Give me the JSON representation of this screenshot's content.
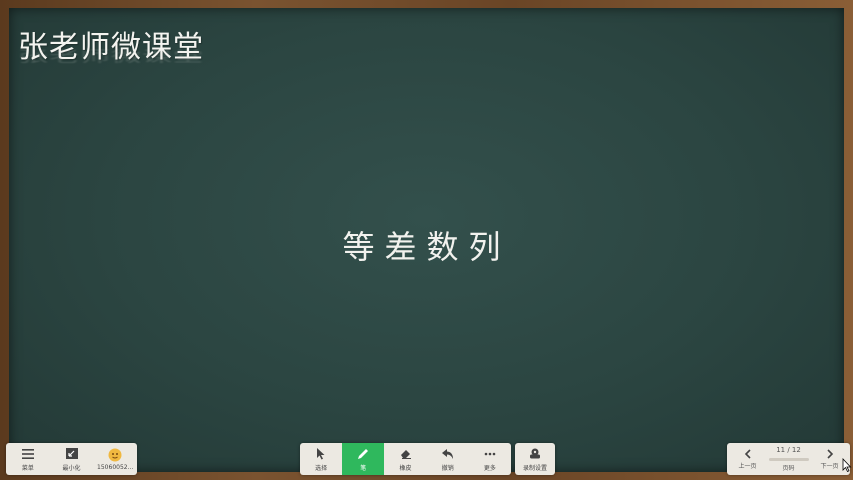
{
  "board": {
    "title": "张老师微课堂",
    "content_text": "等差数列"
  },
  "toolbar_left": [
    {
      "label": "菜单",
      "icon": "menu-icon"
    },
    {
      "label": "最小化",
      "icon": "minimize-icon"
    },
    {
      "label": "15060052...",
      "icon": "avatar-icon"
    }
  ],
  "toolbar_tools": [
    {
      "label": "选择",
      "icon": "pointer-icon"
    },
    {
      "label": "笔",
      "icon": "pen-icon"
    },
    {
      "label": "橡皮",
      "icon": "eraser-icon"
    },
    {
      "label": "撤销",
      "icon": "undo-icon"
    },
    {
      "label": "更多",
      "icon": "more-icon"
    }
  ],
  "toolbar_record": {
    "label": "录制设置",
    "icon": "record-icon"
  },
  "pagination": {
    "prev_label": "上一页",
    "page_text": "11 / 12",
    "page_label": "页码",
    "next_label": "下一页"
  },
  "colors": {
    "board": "#2b4541",
    "frame": "#6a4526",
    "active_tool": "#2fb85d"
  }
}
